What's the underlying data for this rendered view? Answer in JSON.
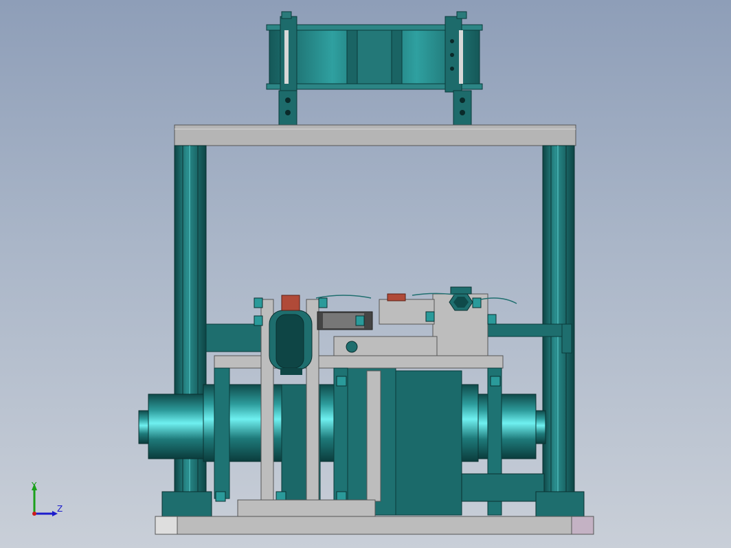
{
  "view": {
    "background_top": "#8e9eb8",
    "background_bottom": "#c9cfd8"
  },
  "triad": {
    "y_label": "Y",
    "z_label": "Z",
    "y_color": "#1aa01a",
    "z_color": "#1c1ccc",
    "x_color": "#cc1c1c"
  },
  "colors": {
    "teal": "#1e6e6e",
    "teal_dark": "#0f4a4a",
    "teal_light": "#2c9a9a",
    "cyan_highlight": "#5fe0e0",
    "frame_gray": "#b8b8b8",
    "frame_gray_dark": "#8a8a8a",
    "red_part": "#b04a38"
  }
}
